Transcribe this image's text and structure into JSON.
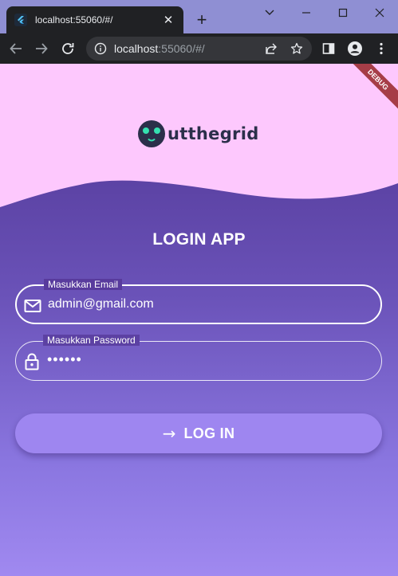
{
  "browser": {
    "tab": {
      "title": "localhost:55060/#/",
      "close_glyph": "✕"
    },
    "new_tab_glyph": "+",
    "address": {
      "host": "localhost",
      "path": ":55060/#/"
    },
    "icons": [
      "flutter-favicon",
      "back-icon",
      "forward-icon",
      "reload-icon",
      "info-icon",
      "share-icon",
      "star-icon",
      "side-panel-icon",
      "profile-icon",
      "menu-icon",
      "minimize-icon",
      "maximize-icon",
      "close-icon",
      "chevron-down-icon"
    ]
  },
  "app": {
    "logo_text": "utthegrid",
    "debug_banner": "DEBUG",
    "title": "LOGIN APP",
    "email": {
      "label": "Masukkan Email",
      "value": "admin@gmail.com",
      "icon": "mail-icon"
    },
    "password": {
      "label": "Masukkan Password",
      "value": "••••••",
      "icon": "lock-icon"
    },
    "login_button": {
      "arrow_glyph": "→",
      "label": "LOG IN"
    }
  },
  "colors": {
    "header_bg": "#fdc8fd",
    "gradient_top": "#4d3390",
    "gradient_bottom": "#a089f0",
    "button": "#9e86f0",
    "debug": "#a63d47",
    "logo_dark": "#2b2f4a",
    "logo_accent": "#35e0b0"
  }
}
